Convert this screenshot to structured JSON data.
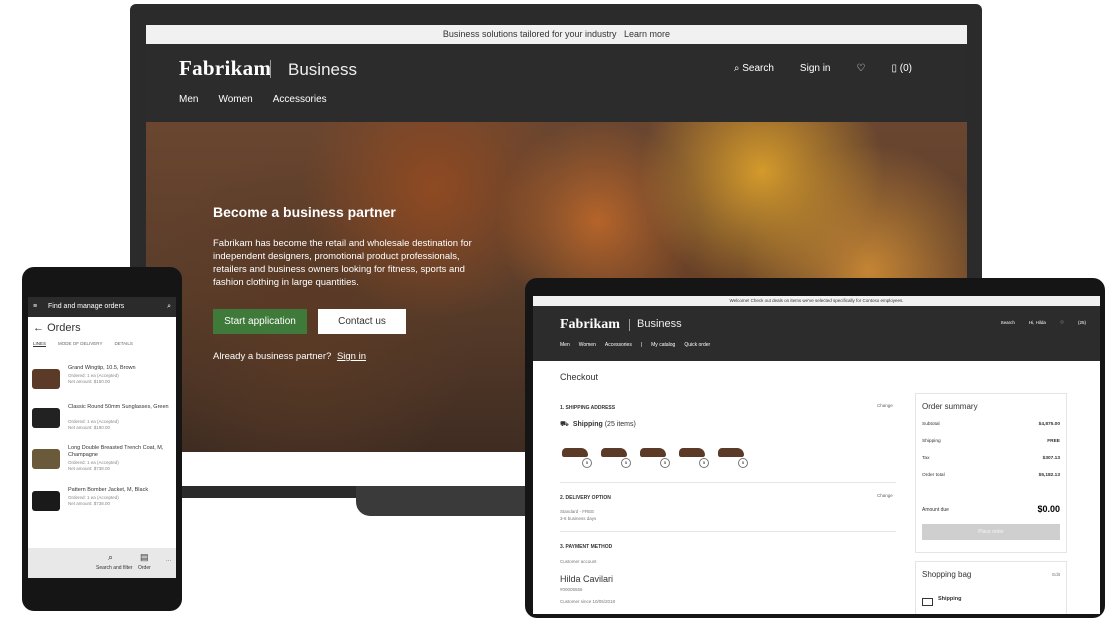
{
  "laptop": {
    "topbar": {
      "text": "Business solutions tailored for your industry",
      "link": "Learn more"
    },
    "brand": "Fabrikam",
    "brand_sub": "Business",
    "nav_right": {
      "search": "Search",
      "signin": "Sign in",
      "cart": "(0)"
    },
    "menu": [
      "Men",
      "Women",
      "Accessories"
    ],
    "hero": {
      "title": "Become a business partner",
      "text": "Fabrikam has become the retail and wholesale destination for independent designers, promotional product professionals, retailers and business owners looking for fitness, sports and fashion clothing in large quantities.",
      "start_label": "Start application",
      "contact_label": "Contact us",
      "already_text": "Already a business partner?",
      "signin_link": "Sign in"
    }
  },
  "phone": {
    "header_title": "Find and manage orders",
    "page_title": "Orders",
    "tabs": [
      "LINES",
      "MODE OF DELIVERY",
      "DETAILS"
    ],
    "items": [
      {
        "name": "Grand Wingtip, 10.5, Brown",
        "meta1": "Ordered: 1 ea (Accepted)",
        "meta2": "Net amount: $150.00",
        "color": "#5b3a28"
      },
      {
        "name": "Classic Round 50mm Sunglasses, Green",
        "meta1": "Ordered: 1 ea (Accepted)",
        "meta2": "Net amount: $190.00",
        "color": "#222222"
      },
      {
        "name": "Long Double Breasted Trench Coat, M, Champagne",
        "meta1": "Ordered: 1 ea (Accepted)",
        "meta2": "Net amount: $738.00",
        "color": "#6b5a3a"
      },
      {
        "name": "Pattern Bomber Jacket, M, Black",
        "meta1": "Ordered: 1 ea (Accepted)",
        "meta2": "Net amount: $738.00",
        "color": "#1a1a1a"
      }
    ],
    "bottom": {
      "search": "Search and filter",
      "order": "Order"
    }
  },
  "tablet": {
    "topbar": "Welcome! Check out deals on items we've selected specifically for Contoso employees.",
    "brand": "Fabrikam",
    "brand_sub": "Business",
    "nav": [
      "Men",
      "Women",
      "Accessories",
      "|",
      "My catalog",
      "Quick order"
    ],
    "right": {
      "search": "Search",
      "user": "Hi, Hilda",
      "cart": "(25)"
    },
    "checkout_title": "Checkout",
    "shipping": {
      "heading": "1. SHIPPING ADDRESS",
      "change": "Change",
      "label": "Shipping",
      "count": "(25 items)",
      "badges": [
        "5",
        "5",
        "5",
        "5",
        "5"
      ]
    },
    "delivery": {
      "heading": "2. DELIVERY OPTION",
      "change": "Change",
      "line1": "Standard - FREE",
      "line2": "3-6 business days"
    },
    "payment": {
      "heading": "3. PAYMENT METHOD",
      "account_label": "Customer account",
      "name": "Hilda Cavilari",
      "number": "#00005555",
      "since": "Customer since 10/05/2018"
    },
    "summary": {
      "title": "Order summary",
      "rows": [
        {
          "label": "Subtotal",
          "value": "$4,875.00"
        },
        {
          "label": "Shipping",
          "value": "FREE"
        },
        {
          "label": "Tax",
          "value": "$307.13"
        },
        {
          "label": "Order total",
          "value": "$5,182.13"
        }
      ],
      "due_label": "Amount due",
      "due_value": "$0.00",
      "place_order": "Place order"
    },
    "bag": {
      "title": "Shopping bag",
      "edit": "Edit",
      "shipping": "Shipping"
    }
  }
}
